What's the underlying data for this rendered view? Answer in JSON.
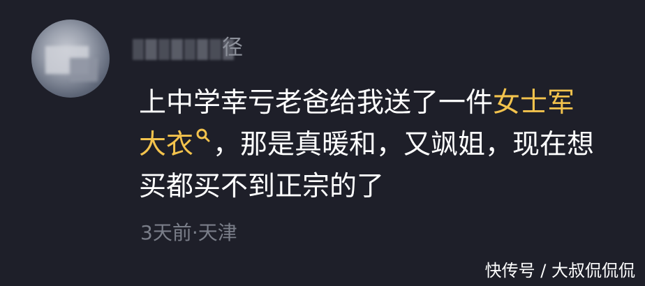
{
  "comment": {
    "username_visible": "径",
    "line1_plain": "上中学幸亏老爸给我送了一件",
    "link_part1": "女士军",
    "link_part2": "大衣",
    "line2_plain": "，那是真暖和，又飒姐，现在想",
    "line3_plain": "买都买不到正宗的了",
    "meta": "3天前·天津",
    "link_icon": "search-icon",
    "link_color": "#f3c34d"
  },
  "watermark": "快传号 / 大叔侃侃侃"
}
